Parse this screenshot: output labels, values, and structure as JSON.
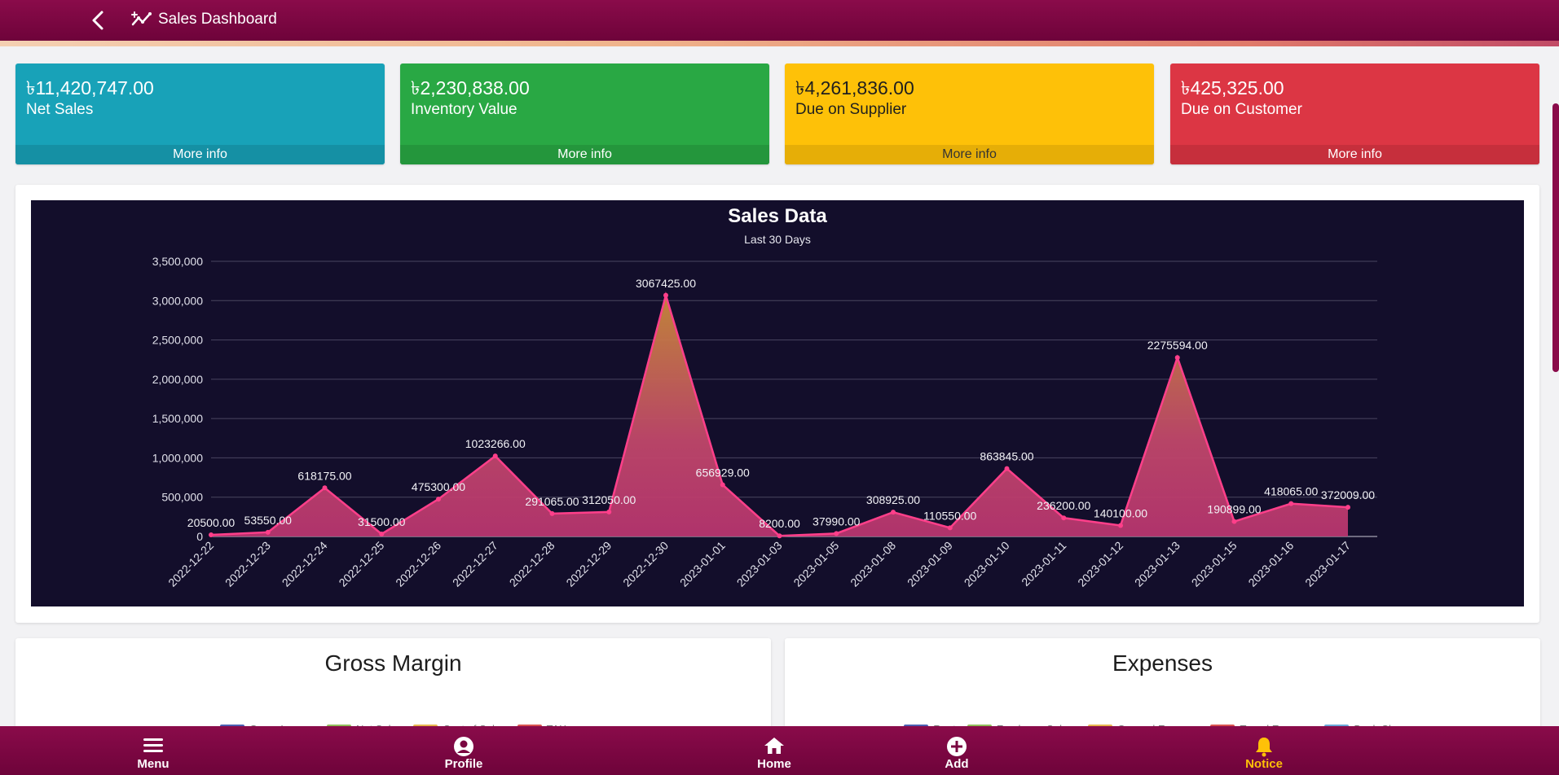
{
  "header": {
    "title": "Sales Dashboard",
    "back_icon": "chevron-left-icon",
    "title_icon": "chart-sparkle-icon"
  },
  "colors": {
    "header": "#7a0640",
    "card_teal": "#18a2b8",
    "card_green": "#29a844",
    "card_yellow": "#fec108",
    "card_red": "#dc3644",
    "chart_bg": "#130e2b",
    "chart_line": "#ff3f8a",
    "nav_active": "#fec108"
  },
  "cards": [
    {
      "amount": "৳11,420,747.00",
      "label": "Net Sales",
      "more": "More info"
    },
    {
      "amount": "৳2,230,838.00",
      "label": "Inventory Value",
      "more": "More info"
    },
    {
      "amount": "৳4,261,836.00",
      "label": "Due on Supplier",
      "more": "More info"
    },
    {
      "amount": "৳425,325.00",
      "label": "Due on Customer",
      "more": "More info"
    }
  ],
  "chart_data": {
    "type": "area",
    "title": "Sales Data",
    "subtitle": "Last 30 Days",
    "xlabel": "",
    "ylabel": "",
    "ylim": [
      0,
      3500000
    ],
    "yticks": [
      "0",
      "500,000",
      "1,000,000",
      "1,500,000",
      "2,000,000",
      "2,500,000",
      "3,000,000",
      "3,500,000"
    ],
    "x": [
      "2022-12-22",
      "2022-12-23",
      "2022-12-24",
      "2022-12-25",
      "2022-12-26",
      "2022-12-27",
      "2022-12-28",
      "2022-12-29",
      "2022-12-30",
      "2023-01-01",
      "2023-01-03",
      "2023-01-05",
      "2023-01-08",
      "2023-01-09",
      "2023-01-10",
      "2023-01-11",
      "2023-01-12",
      "2023-01-13",
      "2023-01-15",
      "2023-01-16",
      "2023-01-17"
    ],
    "y": [
      20500,
      53550,
      618175,
      31500,
      475300,
      1023266,
      291065,
      312050,
      3067425,
      656929,
      8200,
      37990,
      308925,
      110550,
      863845,
      236200,
      140100,
      2275594,
      190899,
      418065,
      372009
    ],
    "data_labels": [
      "20500.00",
      "53550.00",
      "618175.00",
      "31500.00",
      "475300.00",
      "1023266.00",
      "291065.00",
      "312050.00",
      "3067425.00",
      "656929.00",
      "8200.00",
      "37990.00",
      "308925.00",
      "110550.00",
      "863845.00",
      "236200.00",
      "140100.00",
      "2275594.00",
      "190899.00",
      "418065.00",
      "372009.00"
    ],
    "grid": true,
    "legend": "none"
  },
  "panels": {
    "gross_margin": {
      "title": "Gross Margin",
      "legend": [
        {
          "label": "Gross Income",
          "color": "#4b5fb3"
        },
        {
          "label": "Net Sales",
          "color": "#8fbd5a"
        },
        {
          "label": "Cost of Sales",
          "color": "#e8b64d"
        },
        {
          "label": "TAX",
          "color": "#d9534f"
        }
      ]
    },
    "expenses": {
      "title": "Expenses",
      "legend": [
        {
          "label": "Rent",
          "color": "#4b5fb3"
        },
        {
          "label": "Employee Salary",
          "color": "#8fbd5a"
        },
        {
          "label": "General Expense",
          "color": "#e8b64d"
        },
        {
          "label": "Travel Expense",
          "color": "#d9534f"
        },
        {
          "label": "Bank Charges",
          "color": "#6aa7d8"
        }
      ]
    }
  },
  "nav": [
    {
      "label": "Menu",
      "icon": "menu-icon"
    },
    {
      "label": "Profile",
      "icon": "user-circle-icon"
    },
    {
      "label": "Home",
      "icon": "home-icon"
    },
    {
      "label": "Add",
      "icon": "plus-circle-icon"
    },
    {
      "label": "Notice",
      "icon": "bell-icon",
      "active": true
    }
  ]
}
